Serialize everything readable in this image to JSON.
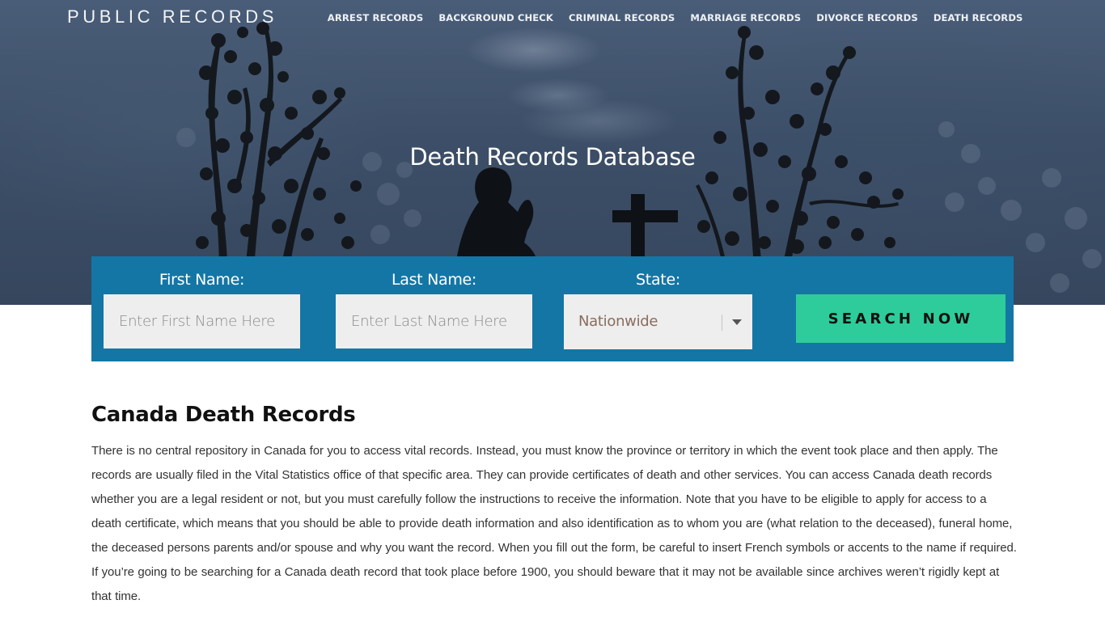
{
  "header": {
    "brand": "PUBLIC RECORDS",
    "nav": [
      {
        "label": "ARREST RECORDS"
      },
      {
        "label": "BACKGROUND CHECK"
      },
      {
        "label": "CRIMINAL RECORDS"
      },
      {
        "label": "MARRIAGE RECORDS"
      },
      {
        "label": "DIVORCE RECORDS"
      },
      {
        "label": "DEATH RECORDS"
      }
    ]
  },
  "hero": {
    "title": "Death Records Database"
  },
  "search": {
    "first_name": {
      "label": "First Name:",
      "placeholder": "Enter First Name Here",
      "value": ""
    },
    "last_name": {
      "label": "Last Name:",
      "placeholder": "Enter Last Name Here",
      "value": ""
    },
    "state": {
      "label": "State:",
      "selected": "Nationwide"
    },
    "submit_label": "SEARCH NOW"
  },
  "article": {
    "heading": "Canada Death Records",
    "body": "There is no central repository in Canada for you to access vital records. Instead, you must know the province or territory in which the event took place and then apply. The records are usually filed in the Vital Statistics office of that specific area. They can provide certificates of death and other services. You can access Canada death records whether you are a legal resident or not, but you must carefully follow the instructions to receive the information. Note that you have to be eligible to apply for access to a death certificate, which means that you should be able to provide death information and also identification as to whom you are (what relation to the deceased), funeral home, the deceased persons parents and/or spouse and why you want the record. When you fill out the form, be careful to insert French symbols or accents to the name if required. If you’re going to be searching for a Canada death record that took place before 1900, you should beware that it may not be available since archives weren’t rigidly kept at that time."
  },
  "colors": {
    "search_panel": "#1476a5",
    "search_button": "#2ecc9a",
    "hero_sky": "#3d4f68"
  }
}
